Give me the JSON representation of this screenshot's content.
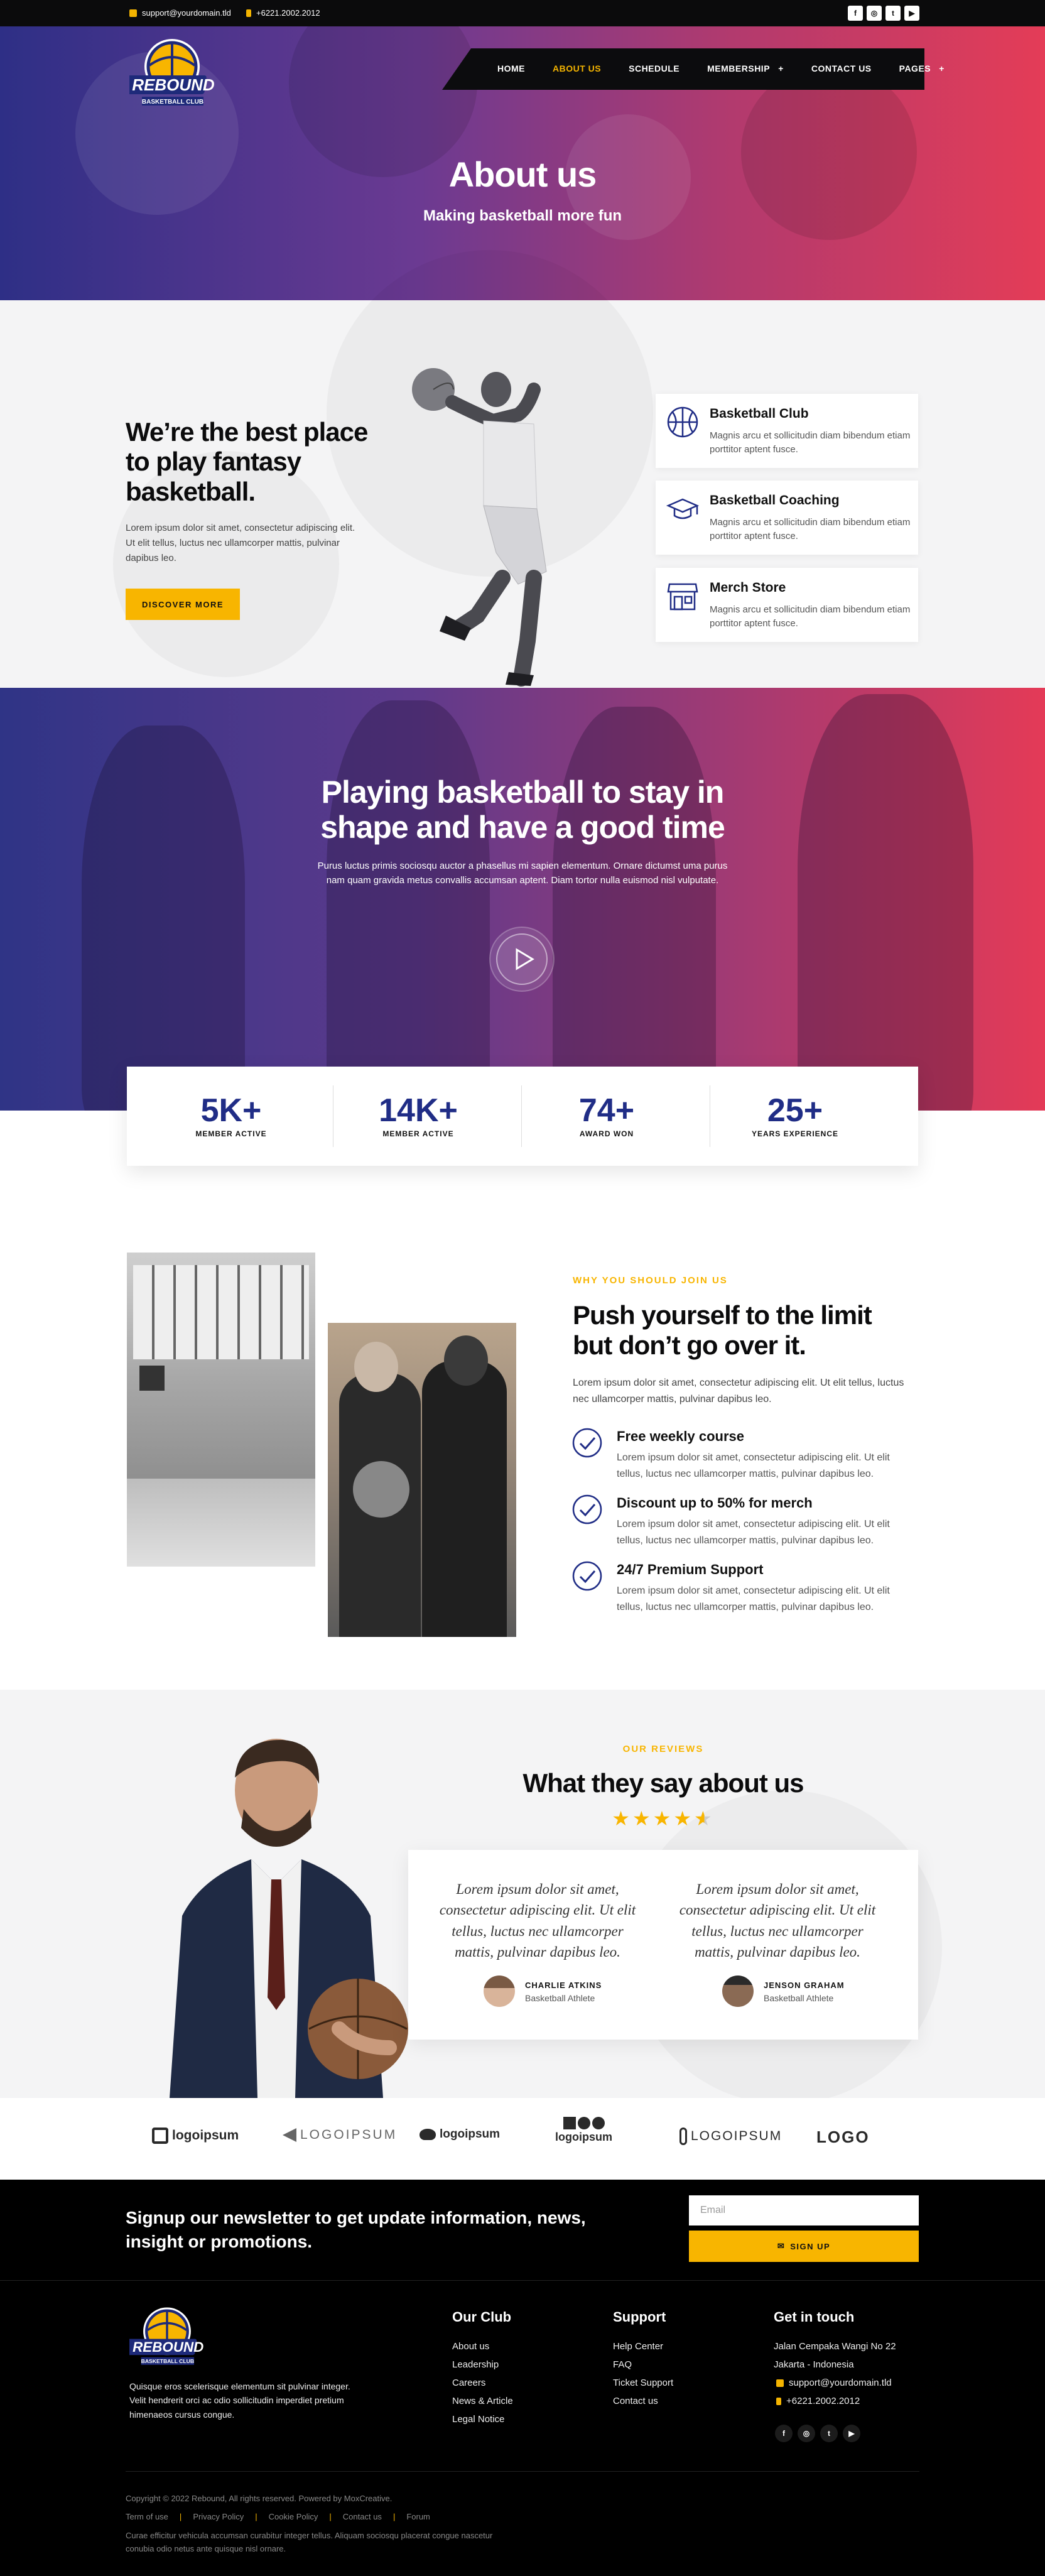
{
  "topbar": {
    "email": "support@yourdomain.tld",
    "phone": "+6221.2002.2012",
    "socials": [
      {
        "name": "facebook-icon",
        "glyph": "f"
      },
      {
        "name": "instagram-icon",
        "glyph": "◎"
      },
      {
        "name": "twitter-icon",
        "glyph": "t"
      },
      {
        "name": "youtube-icon",
        "glyph": "▶"
      }
    ]
  },
  "brand": {
    "name": "REBOUND",
    "tagline": "BASKETBALL CLUB"
  },
  "nav": {
    "items": [
      {
        "label": "HOME"
      },
      {
        "label": "ABOUT US"
      },
      {
        "label": "SCHEDULE"
      },
      {
        "label": "MEMBERSHIP",
        "suffix": "+"
      },
      {
        "label": "CONTACT US"
      },
      {
        "label": "PAGES",
        "suffix": "+"
      }
    ]
  },
  "hero": {
    "title": "About us",
    "subtitle": "Making basketball more fun"
  },
  "intro": {
    "heading": "We’re the best place to play fantasy basketball.",
    "text": "Lorem ipsum dolor sit amet, consectetur adipiscing elit. Ut elit tellus, luctus nec ullamcorper mattis, pulvinar dapibus leo.",
    "button": "DISCOVER MORE",
    "cards": [
      {
        "title": "Basketball Club",
        "text": "Magnis arcu et sollicitudin diam bibendum etiam porttitor aptent fusce.",
        "icon": "basketball-icon"
      },
      {
        "title": "Basketball Coaching",
        "text": "Magnis arcu et sollicitudin diam bibendum etiam porttitor aptent fusce.",
        "icon": "graduation-cap-icon"
      },
      {
        "title": "Merch Store",
        "text": "Magnis arcu et sollicitudin diam bibendum etiam porttitor aptent fusce.",
        "icon": "store-icon"
      }
    ]
  },
  "shape": {
    "heading": "Playing basketball to stay in shape and have a good time",
    "text": "Purus luctus primis sociosqu auctor a phasellus mi sapien elementum. Ornare dictumst uma purus nam quam gravida metus convallis accumsan aptent. Diam tortor nulla euismod nisl vulputate."
  },
  "stats": [
    {
      "value": "5K+",
      "label": "MEMBER ACTIVE"
    },
    {
      "value": "14K+",
      "label": "MEMBER ACTIVE"
    },
    {
      "value": "74+",
      "label": "AWARD WON"
    },
    {
      "value": "25+",
      "label": "YEARS EXPERIENCE"
    }
  ],
  "join": {
    "eyebrow": "WHY YOU SHOULD JOIN US",
    "heading": "Push yourself to the limit but don’t go over it.",
    "text": "Lorem ipsum dolor sit amet, consectetur adipiscing elit. Ut elit tellus, luctus nec ullamcorper mattis, pulvinar dapibus leo.",
    "features": [
      {
        "title": "Free weekly course",
        "text": "Lorem ipsum dolor sit amet, consectetur adipiscing elit. Ut elit tellus, luctus nec ullamcorper mattis, pulvinar dapibus leo."
      },
      {
        "title": "Discount up to 50% for merch",
        "text": "Lorem ipsum dolor sit amet, consectetur adipiscing elit. Ut elit tellus, luctus nec ullamcorper mattis, pulvinar dapibus leo."
      },
      {
        "title": "24/7 Premium Support",
        "text": "Lorem ipsum dolor sit amet, consectetur adipiscing elit. Ut elit tellus, luctus nec ullamcorper mattis, pulvinar dapibus leo."
      }
    ]
  },
  "reviews": {
    "eyebrow": "OUR REVIEWS",
    "heading": "What they say about us",
    "rating": 4.5,
    "items": [
      {
        "quote": "Lorem ipsum dolor sit amet, consectetur adipiscing elit. Ut elit tellus, luctus nec ullamcorper mattis, pulvinar dapibus leo.",
        "name": "CHARLIE ATKINS",
        "role": "Basketball Athlete"
      },
      {
        "quote": "Lorem ipsum dolor sit amet, consectetur adipiscing elit. Ut elit tellus, luctus nec ullamcorper mattis, pulvinar dapibus leo.",
        "name": "JENSON GRAHAM",
        "role": "Basketball Athlete"
      }
    ]
  },
  "logos": [
    "logoipsum",
    "LOGOIPSUM",
    "logoipsum",
    "logoipsum",
    "LOGOIPSUM",
    "LOGO"
  ],
  "newsletter": {
    "text": "Signup our newsletter to get update information, news, insight or promotions.",
    "placeholder": "Email",
    "button": "SIGN UP"
  },
  "footer": {
    "about": "Quisque eros scelerisque elementum sit pulvinar integer. Velit hendrerit orci ac odio sollicitudin imperdiet pretium himenaeos cursus congue.",
    "club": {
      "title": "Our Club",
      "links": [
        "About us",
        "Leadership",
        "Careers",
        "News & Article",
        "Legal Notice"
      ]
    },
    "support": {
      "title": "Support",
      "links": [
        "Help Center",
        "FAQ",
        "Ticket Support",
        "Contact us"
      ]
    },
    "contact": {
      "title": "Get in touch",
      "address1": "Jalan Cempaka Wangi No 22",
      "address2": "Jakarta - Indonesia",
      "email": "support@yourdomain.tld",
      "phone": "+6221.2002.2012"
    },
    "copyright": "Copyright © 2022 Rebound, All rights reserved. Powered by MoxCreative.",
    "legal": [
      "Term of use",
      "Privacy Policy",
      "Cookie Policy",
      "Contact us",
      "Forum"
    ],
    "disclaimer": "Curae efficitur vehicula accumsan curabitur integer tellus. Aliquam sociosqu placerat congue nascetur conubia odio netus ante quisque nisl ornare."
  },
  "colors": {
    "accent": "#f8b500",
    "navy": "#202d86",
    "hero_left": "#2e2f86",
    "hero_right": "#e43c57"
  }
}
